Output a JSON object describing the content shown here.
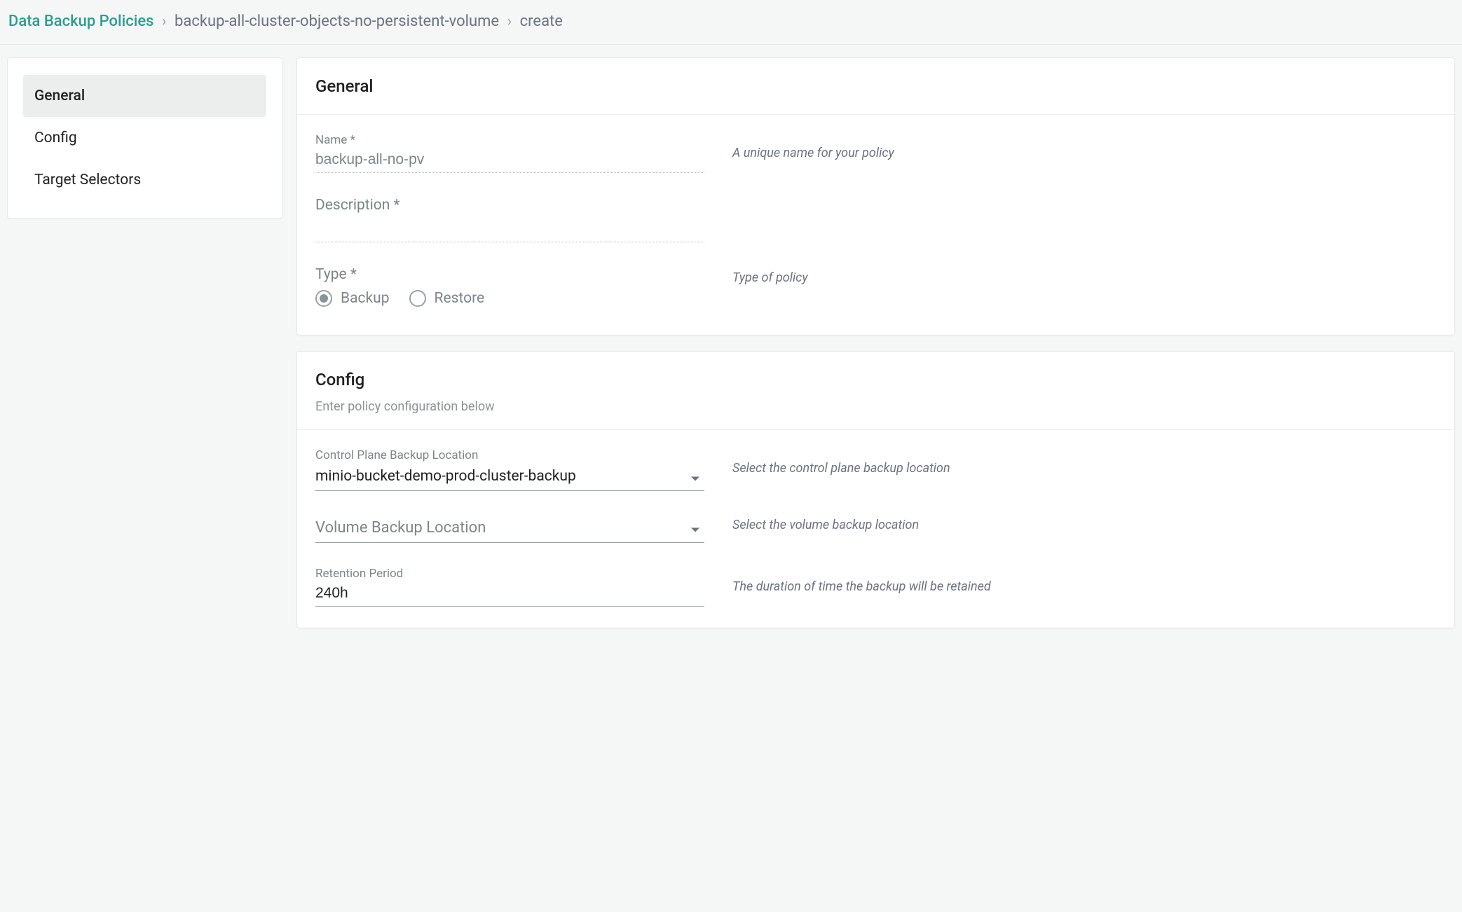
{
  "breadcrumb": {
    "root": "Data Backup Policies",
    "mid": "backup-all-cluster-objects-no-persistent-volume",
    "leaf": "create",
    "sep": "›"
  },
  "sidenav": {
    "items": [
      {
        "label": "General",
        "active": true
      },
      {
        "label": "Config",
        "active": false
      },
      {
        "label": "Target Selectors",
        "active": false
      }
    ]
  },
  "general": {
    "title": "General",
    "name": {
      "label": "Name *",
      "value": "backup-all-no-pv",
      "help": "A unique name for your policy"
    },
    "description": {
      "label": "Description *",
      "value": ""
    },
    "type": {
      "label": "Type *",
      "help": "Type of policy",
      "options": [
        {
          "label": "Backup",
          "selected": true
        },
        {
          "label": "Restore",
          "selected": false
        }
      ]
    }
  },
  "config": {
    "title": "Config",
    "subtitle": "Enter policy configuration below",
    "controlPlane": {
      "label": "Control Plane Backup Location",
      "value": "minio-bucket-demo-prod-cluster-backup",
      "help": "Select the control plane backup location"
    },
    "volume": {
      "label": "Volume Backup Location",
      "value": "",
      "help": "Select the volume backup location"
    },
    "retention": {
      "label": "Retention Period",
      "value": "240h",
      "help": "The duration of time the backup will be retained"
    }
  }
}
